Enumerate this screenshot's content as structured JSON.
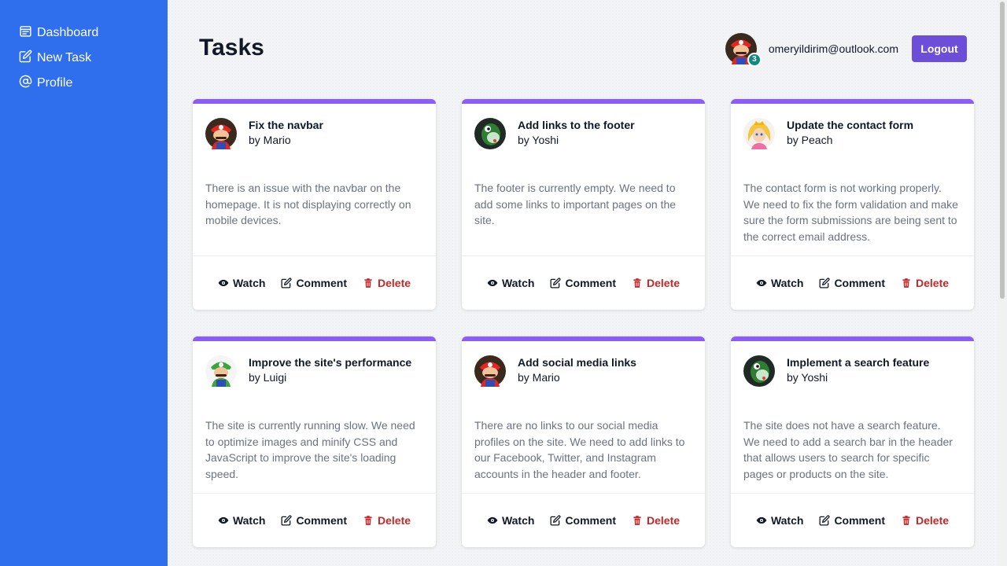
{
  "sidebar": {
    "items": [
      {
        "label": "Dashboard",
        "icon": "calendar-icon"
      },
      {
        "label": "New Task",
        "icon": "edit-icon"
      },
      {
        "label": "Profile",
        "icon": "at-icon"
      }
    ]
  },
  "header": {
    "title": "Tasks",
    "user_email": "omeryildirim@outlook.com",
    "notification_count": "3",
    "logout_label": "Logout"
  },
  "actions": {
    "watch": "Watch",
    "comment": "Comment",
    "delete": "Delete"
  },
  "colors": {
    "sidebar": "#2f6fed",
    "accent": "#8b5cf6",
    "logout": "#6d4ed8",
    "delete": "#c62828"
  },
  "tasks": [
    {
      "title": "Fix the navbar",
      "author": "by Mario",
      "avatar": "mario",
      "description": "There is an issue with the navbar on the homepage. It is not displaying correctly on mobile devices."
    },
    {
      "title": "Add links to the footer",
      "author": "by Yoshi",
      "avatar": "yoshi",
      "description": "The footer is currently empty. We need to add some links to important pages on the site."
    },
    {
      "title": "Update the contact form",
      "author": "by Peach",
      "avatar": "peach",
      "description": "The contact form is not working properly. We need to fix the form validation and make sure the form submissions are being sent to the correct email address."
    },
    {
      "title": "Improve the site's performance",
      "author": "by Luigi",
      "avatar": "luigi",
      "description": "The site is currently running slow. We need to optimize images and minify CSS and JavaScript to improve the site's loading speed."
    },
    {
      "title": "Add social media links",
      "author": "by Mario",
      "avatar": "mario",
      "description": "There are no links to our social media profiles on the site. We need to add links to our Facebook, Twitter, and Instagram accounts in the header and footer."
    },
    {
      "title": "Implement a search feature",
      "author": "by Yoshi",
      "avatar": "yoshi",
      "description": "The site does not have a search feature. We need to add a search bar in the header that allows users to search for specific pages or products on the site."
    }
  ]
}
